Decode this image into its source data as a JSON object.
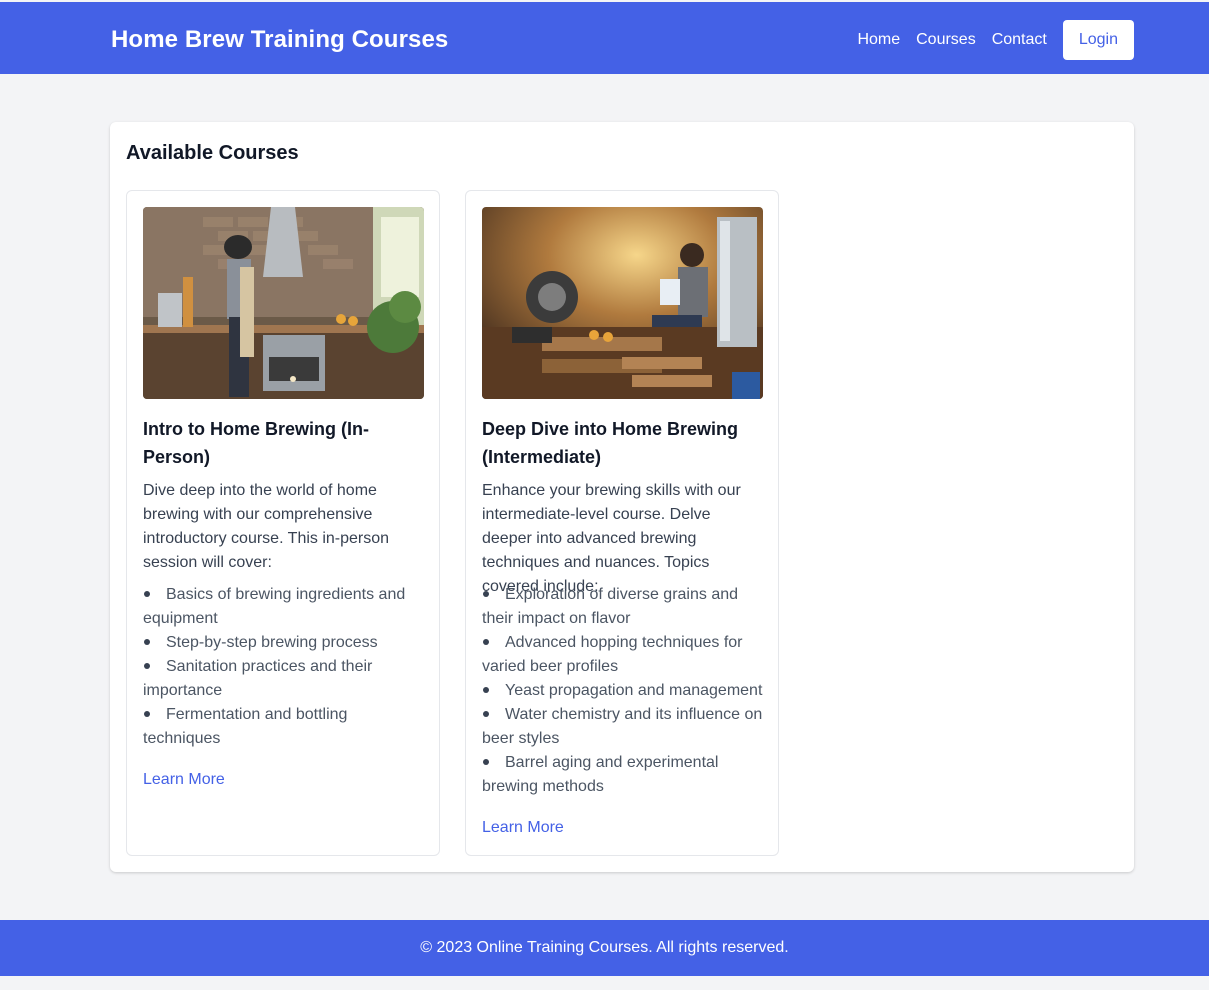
{
  "header": {
    "brand": "Home Brew Training Courses",
    "nav": [
      "Home",
      "Courses",
      "Contact"
    ],
    "login_label": "Login"
  },
  "main": {
    "title": "Available Courses",
    "courses": [
      {
        "title": "Intro to Home Brewing (In-Person)",
        "description": "Dive deep into the world of home brewing with our comprehensive introductory course. This in-person session will cover:",
        "topics": [
          "Basics of brewing ingredients and equipment",
          "Step-by-step brewing process",
          "Sanitation practices and their importance",
          "Fermentation and bottling techniques"
        ],
        "link_label": "Learn More"
      },
      {
        "title": "Deep Dive into Home Brewing (Intermediate)",
        "description": "Enhance your brewing skills with our intermediate-level course. Delve deeper into advanced brewing techniques and nuances. Topics covered include:",
        "topics": [
          "Exploration of diverse grains and their impact on flavor",
          "Advanced hopping techniques for varied beer profiles",
          "Yeast propagation and management",
          "Water chemistry and its influence on beer styles",
          "Barrel aging and experimental brewing methods"
        ],
        "link_label": "Learn More"
      }
    ]
  },
  "footer": {
    "text": "© 2023 Online Training Courses. All rights reserved."
  },
  "colors": {
    "primary": "#4461e6",
    "background": "#f3f4f6"
  }
}
